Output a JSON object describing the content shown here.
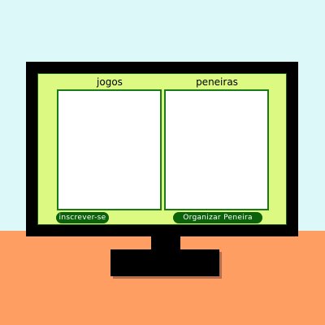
{
  "colors": {
    "wall": "#dcf8f8",
    "desk": "#ff9e62",
    "monitor": "#000000",
    "screen": "#dcfa82",
    "panel_border": "#1a7a1a",
    "panel_fill": "#ffffff",
    "button": "#0b620b",
    "button_text": "#ffffff",
    "base_shadow": "#b46e50"
  },
  "columns": [
    {
      "title": "jogos",
      "button_label": "inscrever-se"
    },
    {
      "title": "peneiras",
      "button_label": "Organizar Peneira"
    }
  ]
}
